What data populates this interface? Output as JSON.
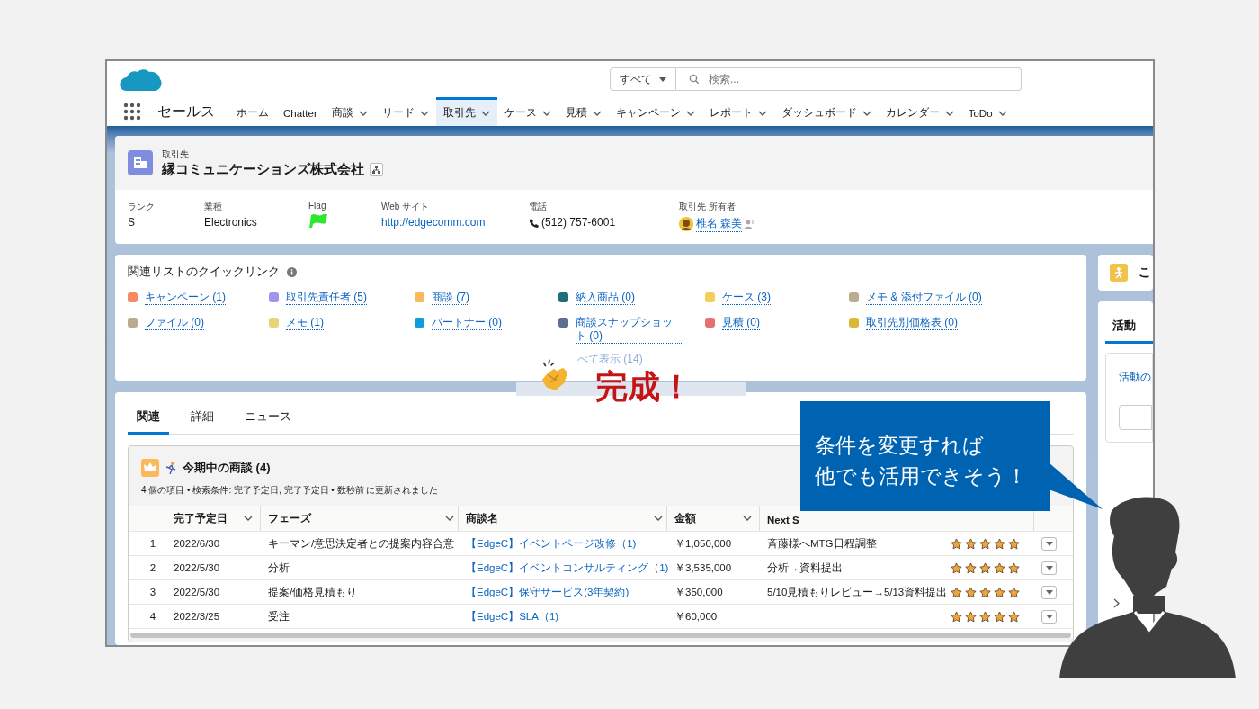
{
  "app": {
    "name": "セールス",
    "search_scope": "すべて",
    "search_placeholder": "検索..."
  },
  "nav": [
    {
      "label": "ホーム",
      "dropdown": false,
      "selected": false
    },
    {
      "label": "Chatter",
      "dropdown": false,
      "selected": false
    },
    {
      "label": "商談",
      "dropdown": true,
      "selected": false
    },
    {
      "label": "リード",
      "dropdown": true,
      "selected": false
    },
    {
      "label": "取引先",
      "dropdown": true,
      "selected": true
    },
    {
      "label": "ケース",
      "dropdown": true,
      "selected": false
    },
    {
      "label": "見積",
      "dropdown": true,
      "selected": false
    },
    {
      "label": "キャンペーン",
      "dropdown": true,
      "selected": false
    },
    {
      "label": "レポート",
      "dropdown": true,
      "selected": false
    },
    {
      "label": "ダッシュボード",
      "dropdown": true,
      "selected": false
    },
    {
      "label": "カレンダー",
      "dropdown": true,
      "selected": false
    },
    {
      "label": "ToDo",
      "dropdown": true,
      "selected": false
    }
  ],
  "record": {
    "type_label": "取引先",
    "name": "縁コミュニケーションズ株式会社",
    "fields": [
      {
        "kind": "text",
        "label": "ランク",
        "value": "S"
      },
      {
        "kind": "text",
        "label": "業種",
        "value": "Electronics"
      },
      {
        "kind": "flag",
        "label": "Flag",
        "color": "#2ee82e"
      },
      {
        "kind": "link",
        "label": "Web サイト",
        "value": "http://edgecomm.com"
      },
      {
        "kind": "phone",
        "label": "電話",
        "value": "(512) 757-6001"
      },
      {
        "kind": "owner",
        "label": "取引先 所有者",
        "value": "椎名 森美"
      }
    ]
  },
  "quick_links": {
    "title": "関連リストのクイックリンク",
    "items": [
      {
        "label": "キャンペーン (1)",
        "color": "#f88962"
      },
      {
        "label": "取引先責任者 (5)",
        "color": "#a094ed"
      },
      {
        "label": "商談 (7)",
        "color": "#fcb95b"
      },
      {
        "label": "納入商品 (0)",
        "color": "#1d6f7a"
      },
      {
        "label": "ケース (3)",
        "color": "#f2cf5b"
      },
      {
        "label": "メモ & 添付ファイル (0)",
        "color": "#baac93"
      },
      {
        "label": "ファイル (0)",
        "color": "#baac93"
      },
      {
        "label": "メモ (1)",
        "color": "#e6d478"
      },
      {
        "label": "パートナー (0)",
        "color": "#0d9dda"
      },
      {
        "label": "商談スナップショット (0)",
        "color": "#5f6f8f"
      },
      {
        "label": "見積 (0)",
        "color": "#ea7070"
      },
      {
        "label": "取引先別価格表 (0)",
        "color": "#d9b83b"
      }
    ],
    "show_all": "べて表示 (14)"
  },
  "related": {
    "tabs": [
      {
        "label": "関連",
        "selected": true
      },
      {
        "label": "詳細",
        "selected": false
      },
      {
        "label": "ニュース",
        "selected": false
      }
    ],
    "list": {
      "title": "今期中の商談 (4)",
      "subtitle": "4 個の項目 • 検索条件: 完了予定日, 完了予定日 • 数秒前 に更新されました",
      "columns": [
        {
          "label": "完了予定日",
          "sortable": true
        },
        {
          "label": "フェーズ",
          "sortable": true
        },
        {
          "label": "商談名",
          "sortable": true
        },
        {
          "label": "金額",
          "sortable": true
        },
        {
          "label": "Next S",
          "sortable": false
        }
      ],
      "rows": [
        {
          "number": "1",
          "date": "2022/6/30",
          "phase": "キーマン/意思決定者との提案内容合意",
          "name": "【EdgeC】イベントページ改修（1)",
          "amount": "￥1,050,000",
          "next_step": "斉藤様へMTG日程調整",
          "stars": 5
        },
        {
          "number": "2",
          "date": "2022/5/30",
          "phase": "分析",
          "name": "【EdgeC】イベントコンサルティング（1)",
          "amount": "￥3,535,000",
          "next_step": "分析→資料提出",
          "stars": 5
        },
        {
          "number": "3",
          "date": "2022/5/30",
          "phase": "提案/価格見積もり",
          "name": "【EdgeC】保守サービス(3年契約)",
          "amount": "￥350,000",
          "next_step": "5/10見積もりレビュー→5/13資料提出",
          "stars": 5
        },
        {
          "number": "4",
          "date": "2022/3/25",
          "phase": "受注",
          "name": "【EdgeC】SLA（1)",
          "amount": "￥60,000",
          "next_step": "",
          "stars": 5
        }
      ]
    }
  },
  "side": {
    "card_title": "こ",
    "tab": "活動",
    "link": "活動の"
  },
  "banner": {
    "text": "完成！"
  },
  "callout": {
    "lines": [
      "条件を変更すれば",
      "他でも活用できそう！"
    ]
  }
}
